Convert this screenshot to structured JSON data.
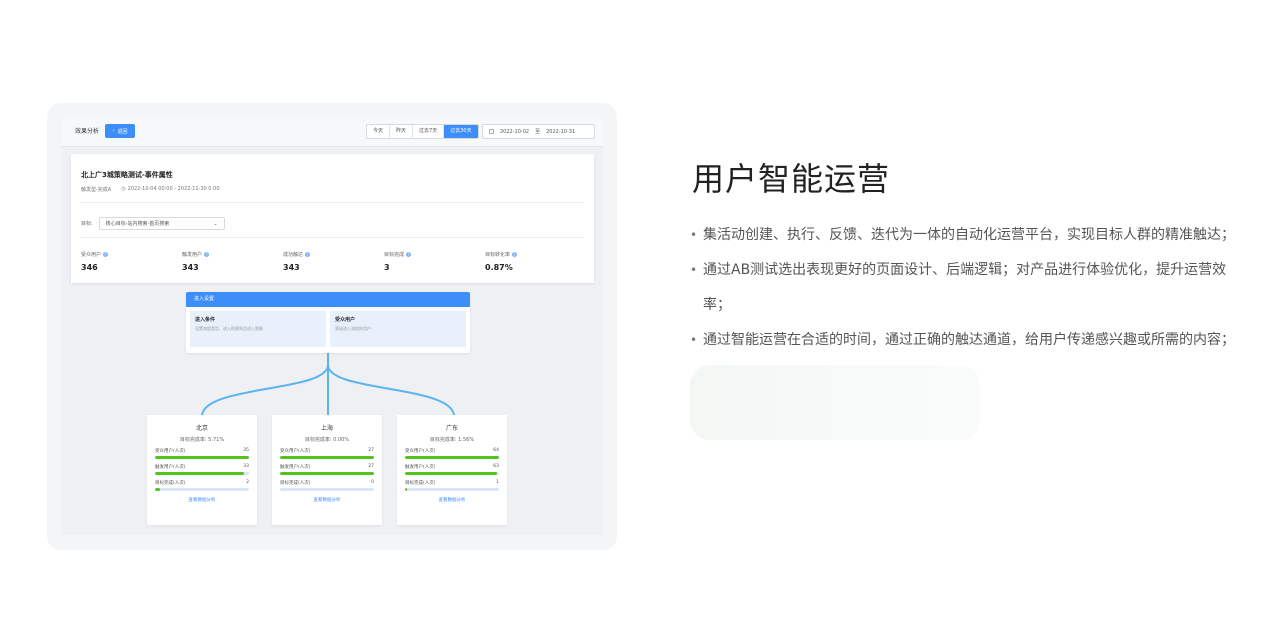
{
  "toolbar": {
    "title": "效果分析",
    "back_label": "返回",
    "ranges": [
      "今天",
      "昨天",
      "过去7天",
      "过去30天"
    ],
    "active_range": "过去30天",
    "date_start": "2022-10-02",
    "date_sep": "至",
    "date_end": "2022-10-31"
  },
  "strategy": {
    "title": "北上广3城策略测试-事件属性",
    "type": "触发型-完成A",
    "period": "2022-10-04 00:00 - 2022-11-30 0:00",
    "goal_label": "目标:",
    "goal_value": "核心目标-站内搜索-首页搜索",
    "metrics": [
      {
        "label": "受众用户",
        "value": "346"
      },
      {
        "label": "触发用户",
        "value": "343"
      },
      {
        "label": "成功触达",
        "value": "343"
      },
      {
        "label": "目标完成",
        "value": "3"
      },
      {
        "label": "目标转化率",
        "value": "0.87%"
      }
    ]
  },
  "entry": {
    "header": "进入设置",
    "condition_title": "进入条件",
    "condition_sub": "设置流程类型、进入的规则及进入限制",
    "audience_title": "受众用户",
    "audience_sub": "筛选进入流程的用户"
  },
  "cities": [
    {
      "name": "北京",
      "rate": "目标完成率: 5.71%",
      "rows": [
        {
          "label": "受众用户(人次)",
          "value": "35",
          "fill": 1.0
        },
        {
          "label": "触发用户(人次)",
          "value": "33",
          "fill": 0.943
        },
        {
          "label": "目标完成(人次)",
          "value": "2",
          "fill": 0.057
        }
      ],
      "link": "查看数据分析"
    },
    {
      "name": "上海",
      "rate": "目标完成率: 0.00%",
      "rows": [
        {
          "label": "受众用户(人次)",
          "value": "27",
          "fill": 1.0
        },
        {
          "label": "触发用户(人次)",
          "value": "27",
          "fill": 1.0
        },
        {
          "label": "目标完成(人次)",
          "value": "0",
          "fill": 0.0
        }
      ],
      "link": "查看数据分析"
    },
    {
      "name": "广东",
      "rate": "目标完成率: 1.56%",
      "rows": [
        {
          "label": "受众用户(人次)",
          "value": "64",
          "fill": 1.0
        },
        {
          "label": "触发用户(人次)",
          "value": "63",
          "fill": 0.984
        },
        {
          "label": "目标完成(人次)",
          "value": "1",
          "fill": 0.016
        }
      ],
      "link": "查看数据分析"
    }
  ],
  "feature": {
    "heading": "用户智能运营",
    "bullets": [
      "集活动创建、执行、反馈、迭代为一体的自动化运营平台，实现目标人群的精准触达；",
      "通过AB测试选出表现更好的页面设计、后端逻辑；对产品进行体验优化，提升运营效率；",
      "通过智能运营在合适的时间，通过正确的触达通道，给用户传递感兴趣或所需的内容；"
    ]
  },
  "colors": {
    "accent": "#3d8ef8",
    "progress": "#52c41a",
    "branch": "#5ab4f0"
  }
}
